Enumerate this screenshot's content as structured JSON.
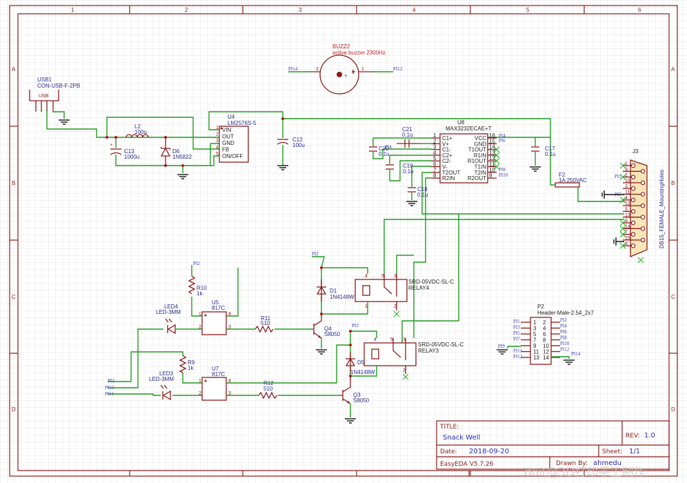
{
  "colors": {
    "wire": "#1f9a1f",
    "component": "#8b1a1a",
    "text": "#2b2b8f",
    "no_connect": "#33bb33",
    "frame": "#8b1a1a"
  },
  "frame": {
    "columns": [
      "1",
      "2",
      "3",
      "4",
      "5",
      "6"
    ],
    "rows": [
      "A",
      "B",
      "C",
      "D"
    ]
  },
  "title_block": {
    "title_label": "TITLE:",
    "title": "Snack Well",
    "rev_label": "REV:",
    "rev": "1.0",
    "date_label": "Date:",
    "date": "2018-09-20",
    "sheet_label": "Sheet:",
    "sheet": "1/1",
    "tool": "EasyEDA V5.7.26",
    "drawn_by_label": "Drawn By:",
    "drawn_by": "ahmedu"
  },
  "watermark": "doit@3D打印手工制作",
  "components": {
    "buz2": {
      "ref": "BUZZ2",
      "value": "active buzzer 2300Hz"
    },
    "usb1": {
      "ref": "USB1",
      "value": "CON-USB-F-2PB",
      "body": "USB"
    },
    "u4": {
      "ref": "U4",
      "value": "LM2576S-5",
      "pins": [
        {
          "num": "1",
          "name": "VIN"
        },
        {
          "num": "2",
          "name": "OUT"
        },
        {
          "num": "3",
          "name": "GND"
        },
        {
          "num": "4",
          "name": "FB"
        },
        {
          "num": "5",
          "name": "ON/OFF"
        }
      ]
    },
    "l2": {
      "ref": "L2",
      "value": "100u"
    },
    "c13": {
      "ref": "C13",
      "value": "1000u"
    },
    "d6": {
      "ref": "D6",
      "value": "1N5822"
    },
    "c12": {
      "ref": "C12",
      "value": "100u"
    },
    "u8": {
      "ref": "U8",
      "value": "MAX3232ECAE+T",
      "left_pins": [
        {
          "num": "1",
          "name": "C1+"
        },
        {
          "num": "2",
          "name": "V+"
        },
        {
          "num": "3",
          "name": "C1-"
        },
        {
          "num": "4",
          "name": "C2+"
        },
        {
          "num": "5",
          "name": "C2-"
        },
        {
          "num": "6",
          "name": "V-"
        },
        {
          "num": "7",
          "name": "T2OUT"
        },
        {
          "num": "8",
          "name": "R2IN"
        }
      ],
      "right_pins": [
        {
          "num": "16",
          "name": "VCC"
        },
        {
          "num": "15",
          "name": "GND"
        },
        {
          "num": "14",
          "name": "T1OUT"
        },
        {
          "num": "13",
          "name": "R1IN"
        },
        {
          "num": "12",
          "name": "R1OUT"
        },
        {
          "num": "11",
          "name": "T1IN"
        },
        {
          "num": "10",
          "name": "T2IN"
        },
        {
          "num": "9",
          "name": "R2OUT"
        }
      ]
    },
    "c21": {
      "ref": "C21",
      "value": "0.1u"
    },
    "c20": {
      "ref": "C20",
      "value": "0.1u"
    },
    "c19": {
      "ref": "C19",
      "value": "0.1u"
    },
    "c18": {
      "ref": "C18",
      "value": "0.1u"
    },
    "c17": {
      "ref": "C17",
      "value": "0.1u"
    },
    "f2": {
      "ref": "F2",
      "value": "1A 250VAC"
    },
    "j3": {
      "ref": "J3",
      "value": "DB15_FEMALE_MountingHoles",
      "pins": [
        "1",
        "9",
        "2",
        "10",
        "3",
        "11",
        "4",
        "12",
        "5",
        "13",
        "6",
        "14",
        "7",
        "15",
        "8"
      ]
    },
    "relay4": {
      "ref": "RELAY4",
      "value": "SRD-05VDC-SL-C",
      "pins": [
        "4",
        "5",
        "3",
        "1",
        "2"
      ]
    },
    "relay3": {
      "ref": "RELAY3",
      "value": "SRD-05VDC-SL-C",
      "pins": [
        "4",
        "5",
        "3",
        "1",
        "2"
      ]
    },
    "d1": {
      "ref": "D1",
      "value": "1N4148W"
    },
    "d5": {
      "ref": "D5",
      "value": "1N4148W"
    },
    "r10": {
      "ref": "R10",
      "value": "1k"
    },
    "r9": {
      "ref": "R9",
      "value": "1k"
    },
    "r11": {
      "ref": "R11",
      "value": "510"
    },
    "r12": {
      "ref": "R12",
      "value": "510"
    },
    "u5": {
      "ref": "U5",
      "value": "817C",
      "pins": [
        "1",
        "2",
        "3",
        "4"
      ]
    },
    "u7": {
      "ref": "U7",
      "value": "817C",
      "pins": [
        "1",
        "2",
        "3",
        "4"
      ]
    },
    "q4": {
      "ref": "Q4",
      "value": "S8050"
    },
    "q3": {
      "ref": "Q3",
      "value": "S8050"
    },
    "led4": {
      "ref": "LED4",
      "value": "LED-3MM"
    },
    "led3": {
      "ref": "LED3",
      "value": "LED-3MM"
    },
    "p2": {
      "ref": "P2",
      "value": "Header-Male-2.54_2x7",
      "left_pins": [
        "1",
        "3",
        "5",
        "7",
        "9",
        "11",
        "13"
      ],
      "right_pins": [
        "2",
        "4",
        "6",
        "8",
        "10",
        "12",
        "14"
      ],
      "left_nets": [
        "PI1",
        "PI3",
        "PI5",
        "PI7",
        "PI9",
        "PI11",
        "PI13"
      ],
      "right_nets": [
        "PI2",
        "PI4",
        "PI6",
        "PI8",
        "PI10",
        "PI12",
        "PI14"
      ]
    }
  },
  "nets": {
    "buz_left": "PI14",
    "buz_right": "PI12",
    "buz_pin_left": "2",
    "buz_pin_right": "1",
    "u8_pi4": "PI4",
    "u8_pi6": "PI6",
    "u8_pi4b": "PI4",
    "u8_pi8": "PI8",
    "u8_pi10": "PI10",
    "j3_pi1": "PI1",
    "j3_pi7": "PI7",
    "r10_pi2": "PI2",
    "d1_pi2": "PI2",
    "d5_pi2": "PI2",
    "left_pi2": "PI2",
    "left_pi13": "PI13",
    "left_pi11": "PI11"
  }
}
